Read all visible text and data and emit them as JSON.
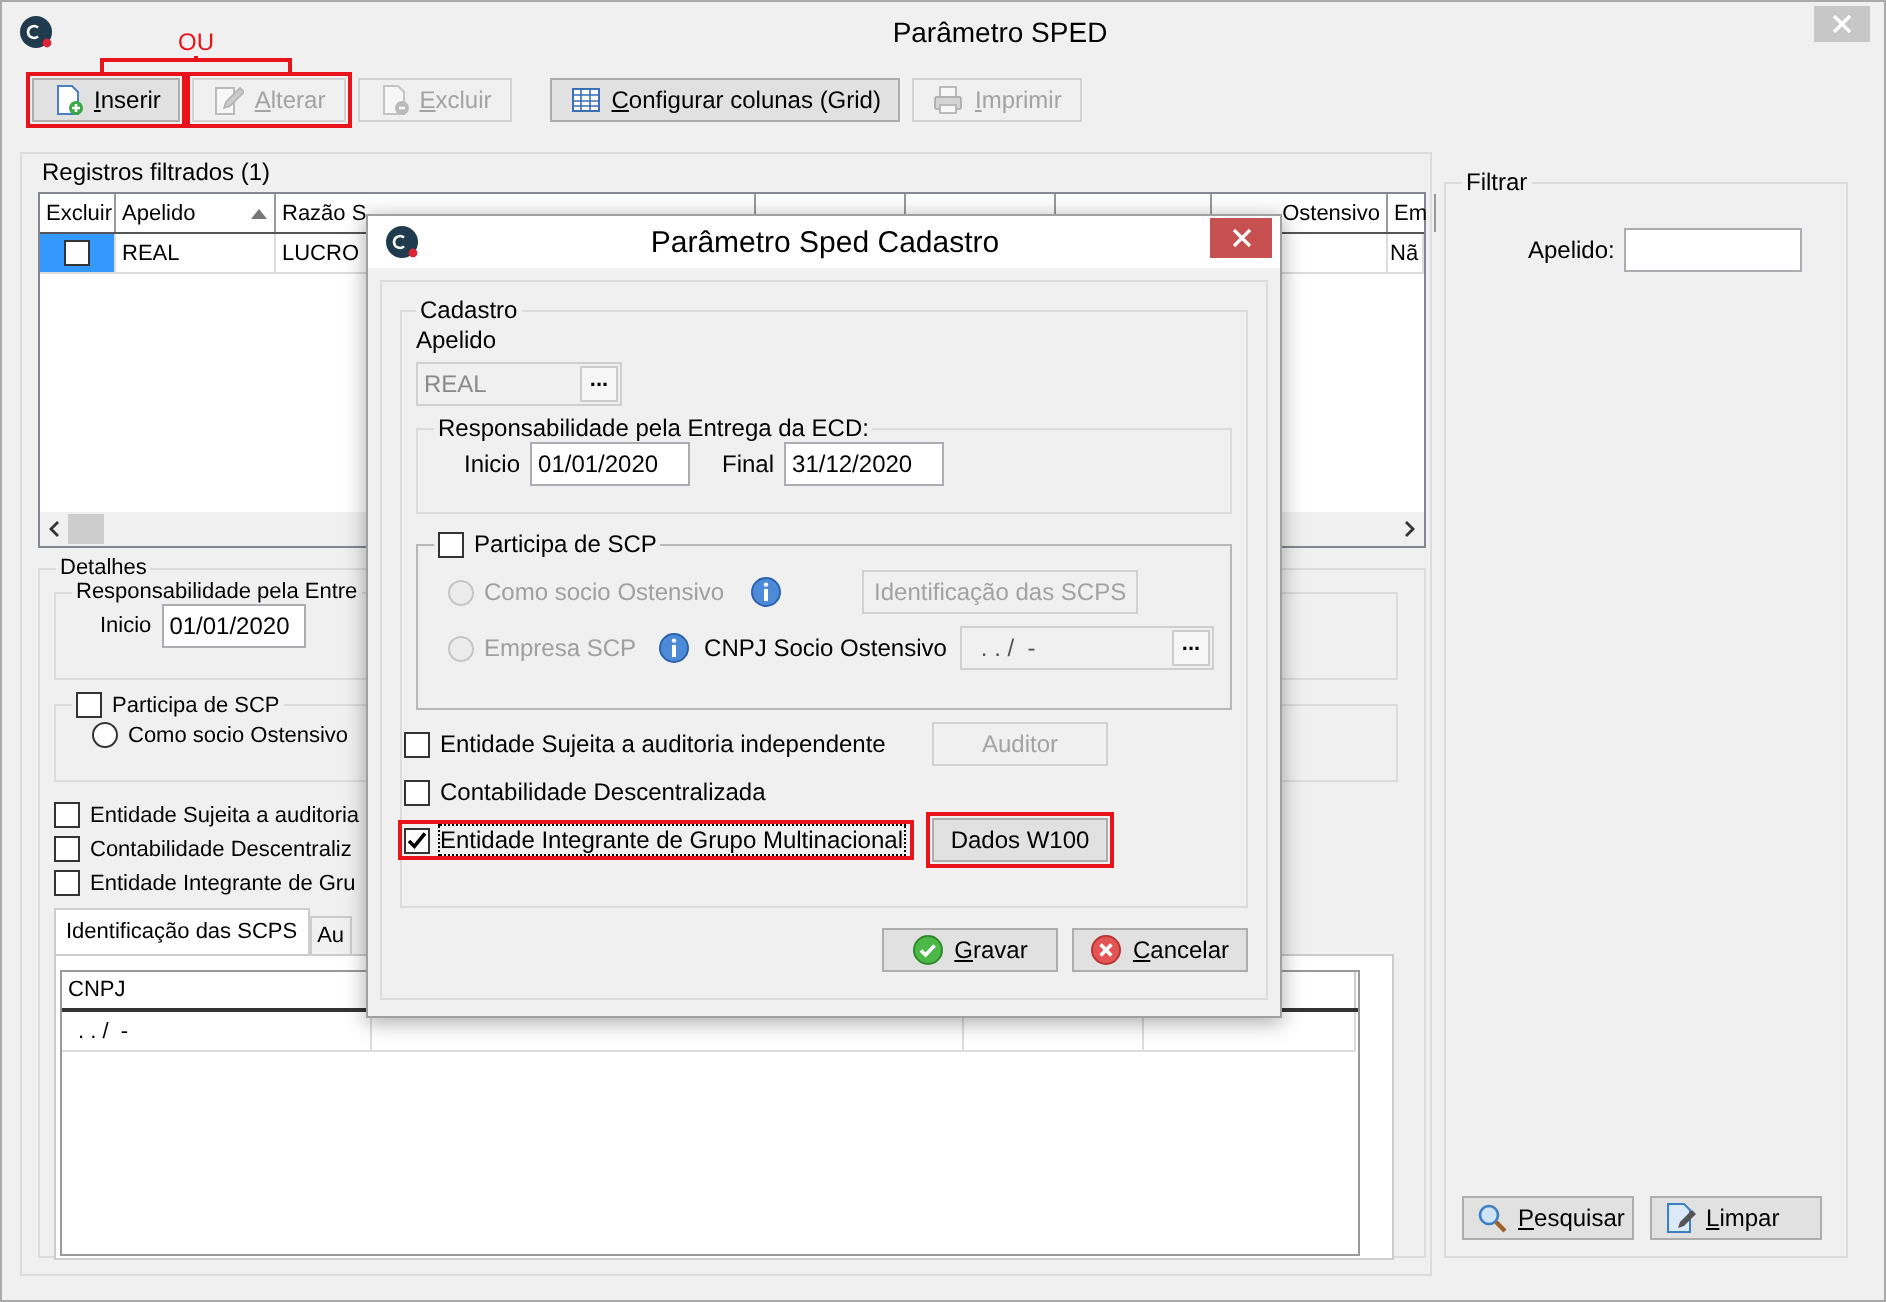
{
  "window": {
    "title": "Parâmetro SPED"
  },
  "annotation": {
    "text": "OU"
  },
  "toolbar": [
    {
      "kind": "new",
      "label": "Inserir",
      "disabled": false,
      "highlighted": true
    },
    {
      "kind": "edit",
      "label": "Alterar",
      "disabled": true,
      "highlighted": true
    },
    {
      "kind": "delete",
      "label": "Excluir",
      "disabled": true,
      "highlighted": false
    },
    {
      "kind": "grid",
      "label": "Configurar colunas (Grid)",
      "disabled": false,
      "highlighted": false
    },
    {
      "kind": "print",
      "label": "Imprimir",
      "disabled": true,
      "highlighted": false
    }
  ],
  "registros": {
    "title": "Registros filtrados (1)",
    "columns": [
      {
        "label": "Excluir",
        "sorted": false
      },
      {
        "label": "Apelido",
        "sorted": true
      },
      {
        "label": "Razão S",
        "sorted": false
      },
      {
        "label": "Ostensivo",
        "sorted": false
      },
      {
        "label": "Em",
        "sorted": false
      }
    ],
    "rows": [
      {
        "selected": true,
        "excluir": false,
        "apelido": "REAL",
        "razao": "LUCRO",
        "em": "Nã"
      }
    ]
  },
  "detalhes": {
    "title": "Detalhes",
    "responsabilidade": {
      "title": "Responsabilidade pela Entre",
      "inicio_label": "Inicio",
      "inicio": "01/01/2020"
    },
    "scp": {
      "label": "Participa de SCP",
      "checked": false,
      "option": {
        "label": "Como socio Ostensivo",
        "selected": false
      }
    },
    "checks": [
      {
        "label": "Entidade Sujeita a auditoria",
        "checked": false
      },
      {
        "label": "Contabilidade Descentraliz",
        "checked": false
      },
      {
        "label": "Entidade Integrante de Gru",
        "checked": false
      }
    ],
    "tabs": [
      {
        "label": "Identificação das SCPS",
        "selected": true
      },
      {
        "label": "Au",
        "selected": false
      }
    ],
    "table": {
      "columns": [
        {
          "label": "CNPJ"
        }
      ],
      "rows": [
        {
          "cnpj": ". . /  -"
        }
      ]
    }
  },
  "filtrar": {
    "title": "Filtrar",
    "apelido_label": "Apelido:",
    "buttons": [
      {
        "kind": "search",
        "label": "Pesquisar"
      },
      {
        "kind": "clear",
        "label": "Limpar"
      }
    ]
  },
  "dialog": {
    "title": "Parâmetro Sped Cadastro",
    "group": "Cadastro",
    "apelido_label": "Apelido",
    "apelido": "REAL",
    "apelido_disabled": true,
    "lookup": "...",
    "responsabilidade": {
      "title": "Responsabilidade pela Entrega da ECD:",
      "inicio_label": "Inicio",
      "inicio": "01/01/2020",
      "final_label": "Final",
      "final": "31/12/2020"
    },
    "scp": {
      "label": "Participa de SCP",
      "checked": false,
      "options": [
        {
          "label": "Como socio Ostensivo",
          "selected": false,
          "disabled": true
        },
        {
          "label": "Empresa SCP",
          "selected": false,
          "disabled": true
        }
      ],
      "scps_button": {
        "label": "Identificação das SCPS",
        "disabled": true
      },
      "cnpj_label": "CNPJ Socio Ostensivo",
      "cnpj": ". . /  -",
      "cnpj_lookup": "..."
    },
    "checks": [
      {
        "label": "Entidade Sujeita a auditoria independente",
        "checked": false,
        "highlighted": false,
        "button": {
          "label": "Auditor",
          "disabled": true,
          "highlighted": false
        }
      },
      {
        "label": "Contabilidade Descentralizada",
        "checked": false,
        "highlighted": false
      },
      {
        "label": "Entidade Integrante de Grupo Multinacional",
        "checked": true,
        "highlighted": true,
        "button": {
          "label": "Dados W100",
          "disabled": false,
          "highlighted": true
        }
      }
    ],
    "buttons": [
      {
        "kind": "ok",
        "label": "Gravar"
      },
      {
        "kind": "cancel",
        "label": "Cancelar"
      }
    ]
  }
}
